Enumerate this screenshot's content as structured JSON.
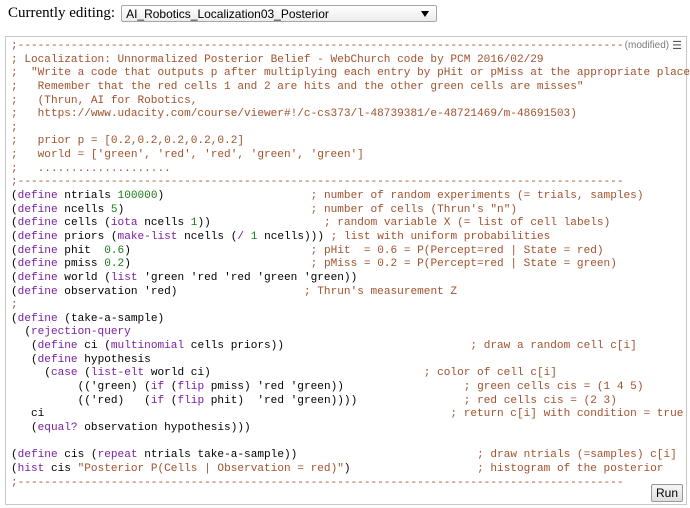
{
  "header": {
    "label": "Currently editing:",
    "selected_program": "AI_Robotics_Localization03_Posterior"
  },
  "editor": {
    "status": "(modified)",
    "run_label": "Run",
    "lines": [
      [
        [
          "c",
          ";-------------------------------------------------------------------------------------------"
        ]
      ],
      [
        [
          "c",
          "; Localization: Unnormalized Posterior Belief - WebChurch code by PCM 2016/02/29"
        ]
      ],
      [
        [
          "c",
          ";  \"Write a code that outputs p after multiplying each entry by pHit or pMiss at the appropriate places."
        ]
      ],
      [
        [
          "c",
          ";   Remember that the red cells 1 and 2 are hits and the other green cells are misses\""
        ]
      ],
      [
        [
          "c",
          ";   (Thrun, AI for Robotics,"
        ]
      ],
      [
        [
          "c",
          ";   https://www.udacity.com/course/viewer#!/c-cs373/l-48739381/e-48721469/m-48691503)"
        ]
      ],
      [
        [
          "c",
          ";"
        ]
      ],
      [
        [
          "c",
          ";   prior p = [0.2,0.2,0.2,0.2,0.2]"
        ]
      ],
      [
        [
          "c",
          ";   world = ['green', 'red', 'red', 'green', 'green']"
        ]
      ],
      [
        [
          "c",
          ";   ...................."
        ]
      ],
      [
        [
          "c",
          ";-------------------------------------------------------------------------------------------"
        ]
      ],
      [
        [
          "t",
          "("
        ],
        [
          "k",
          "define"
        ],
        [
          "t",
          " ntrials "
        ],
        [
          "n",
          "100000"
        ],
        [
          "t",
          ")                      "
        ],
        [
          "c",
          "; number of random experiments (= trials, samples)"
        ]
      ],
      [
        [
          "t",
          "("
        ],
        [
          "k",
          "define"
        ],
        [
          "t",
          " ncells "
        ],
        [
          "n",
          "5"
        ],
        [
          "t",
          ")                            "
        ],
        [
          "c",
          "; number of cells (Thrun's \"n\")"
        ]
      ],
      [
        [
          "t",
          "("
        ],
        [
          "k",
          "define"
        ],
        [
          "t",
          " cells ("
        ],
        [
          "k",
          "iota"
        ],
        [
          "t",
          " ncells "
        ],
        [
          "n",
          "1"
        ],
        [
          "t",
          "))                 "
        ],
        [
          "c",
          "; random variable X (= list of cell labels)"
        ]
      ],
      [
        [
          "t",
          "("
        ],
        [
          "k",
          "define"
        ],
        [
          "t",
          " priors ("
        ],
        [
          "k",
          "make-list"
        ],
        [
          "t",
          " ncells ("
        ],
        [
          "k",
          "/"
        ],
        [
          "t",
          " "
        ],
        [
          "n",
          "1"
        ],
        [
          "t",
          " ncells))) "
        ],
        [
          "c",
          "; list with uniform probabilities"
        ]
      ],
      [
        [
          "t",
          "("
        ],
        [
          "k",
          "define"
        ],
        [
          "t",
          " phit  "
        ],
        [
          "n",
          "0.6"
        ],
        [
          "t",
          ")                           "
        ],
        [
          "c",
          "; pHit  = 0.6 = P(Percept=red | State = red)"
        ]
      ],
      [
        [
          "t",
          "("
        ],
        [
          "k",
          "define"
        ],
        [
          "t",
          " pmiss "
        ],
        [
          "n",
          "0.2"
        ],
        [
          "t",
          ")                           "
        ],
        [
          "c",
          "; pMiss = 0.2 = P(Percept=red | State = green)"
        ]
      ],
      [
        [
          "t",
          "("
        ],
        [
          "k",
          "define"
        ],
        [
          "t",
          " world ("
        ],
        [
          "k",
          "list"
        ],
        [
          "t",
          " 'green 'red 'red 'green 'green))"
        ]
      ],
      [
        [
          "t",
          "("
        ],
        [
          "k",
          "define"
        ],
        [
          "t",
          " observation 'red)                   "
        ],
        [
          "c",
          "; Thrun's measurement Z"
        ]
      ],
      [
        [
          "c",
          ";"
        ]
      ],
      [
        [
          "t",
          "("
        ],
        [
          "k",
          "define"
        ],
        [
          "t",
          " (take-a-sample)"
        ]
      ],
      [
        [
          "t",
          "  ("
        ],
        [
          "k",
          "rejection-query"
        ]
      ],
      [
        [
          "t",
          "   ("
        ],
        [
          "k",
          "define"
        ],
        [
          "t",
          " ci ("
        ],
        [
          "k",
          "multinomial"
        ],
        [
          "t",
          " cells priors))                            "
        ],
        [
          "c",
          "; draw a random cell c[i]"
        ]
      ],
      [
        [
          "t",
          "   ("
        ],
        [
          "k",
          "define"
        ],
        [
          "t",
          " hypothesis"
        ]
      ],
      [
        [
          "t",
          "     ("
        ],
        [
          "k",
          "case"
        ],
        [
          "t",
          " ("
        ],
        [
          "k",
          "list-elt"
        ],
        [
          "t",
          " world ci)                                "
        ],
        [
          "c",
          "; color of cell c[i]"
        ]
      ],
      [
        [
          "t",
          "          (('green) ("
        ],
        [
          "k",
          "if"
        ],
        [
          "t",
          " ("
        ],
        [
          "k",
          "flip"
        ],
        [
          "t",
          " pmiss) 'red 'green))                  "
        ],
        [
          "c",
          "; green cells cis = (1 4 5)"
        ]
      ],
      [
        [
          "t",
          "          (('red)   ("
        ],
        [
          "k",
          "if"
        ],
        [
          "t",
          " ("
        ],
        [
          "k",
          "flip"
        ],
        [
          "t",
          " phit)  'red 'green))))                "
        ],
        [
          "c",
          "; red cells cis = (2 3)"
        ]
      ],
      [
        [
          "t",
          "   ci                                                             "
        ],
        [
          "c",
          "; return c[i] with condition = true"
        ]
      ],
      [
        [
          "t",
          "   ("
        ],
        [
          "k",
          "equal?"
        ],
        [
          "t",
          " observation hypothesis)))"
        ]
      ],
      [
        [
          "t",
          ""
        ]
      ],
      [
        [
          "t",
          "("
        ],
        [
          "k",
          "define"
        ],
        [
          "t",
          " cis ("
        ],
        [
          "k",
          "repeat"
        ],
        [
          "t",
          " ntrials take-a-sample))                           "
        ],
        [
          "c",
          "; draw ntrials (=samples) c[i]"
        ]
      ],
      [
        [
          "t",
          "("
        ],
        [
          "k",
          "hist"
        ],
        [
          "t",
          " cis "
        ],
        [
          "s",
          "\"Posterior P(Cells | Observation = red)\""
        ],
        [
          "t",
          ")                   "
        ],
        [
          "c",
          "; histogram of the posterior"
        ]
      ],
      [
        [
          "c",
          ";-------------------------------------------------------------------------------------------"
        ]
      ]
    ]
  }
}
